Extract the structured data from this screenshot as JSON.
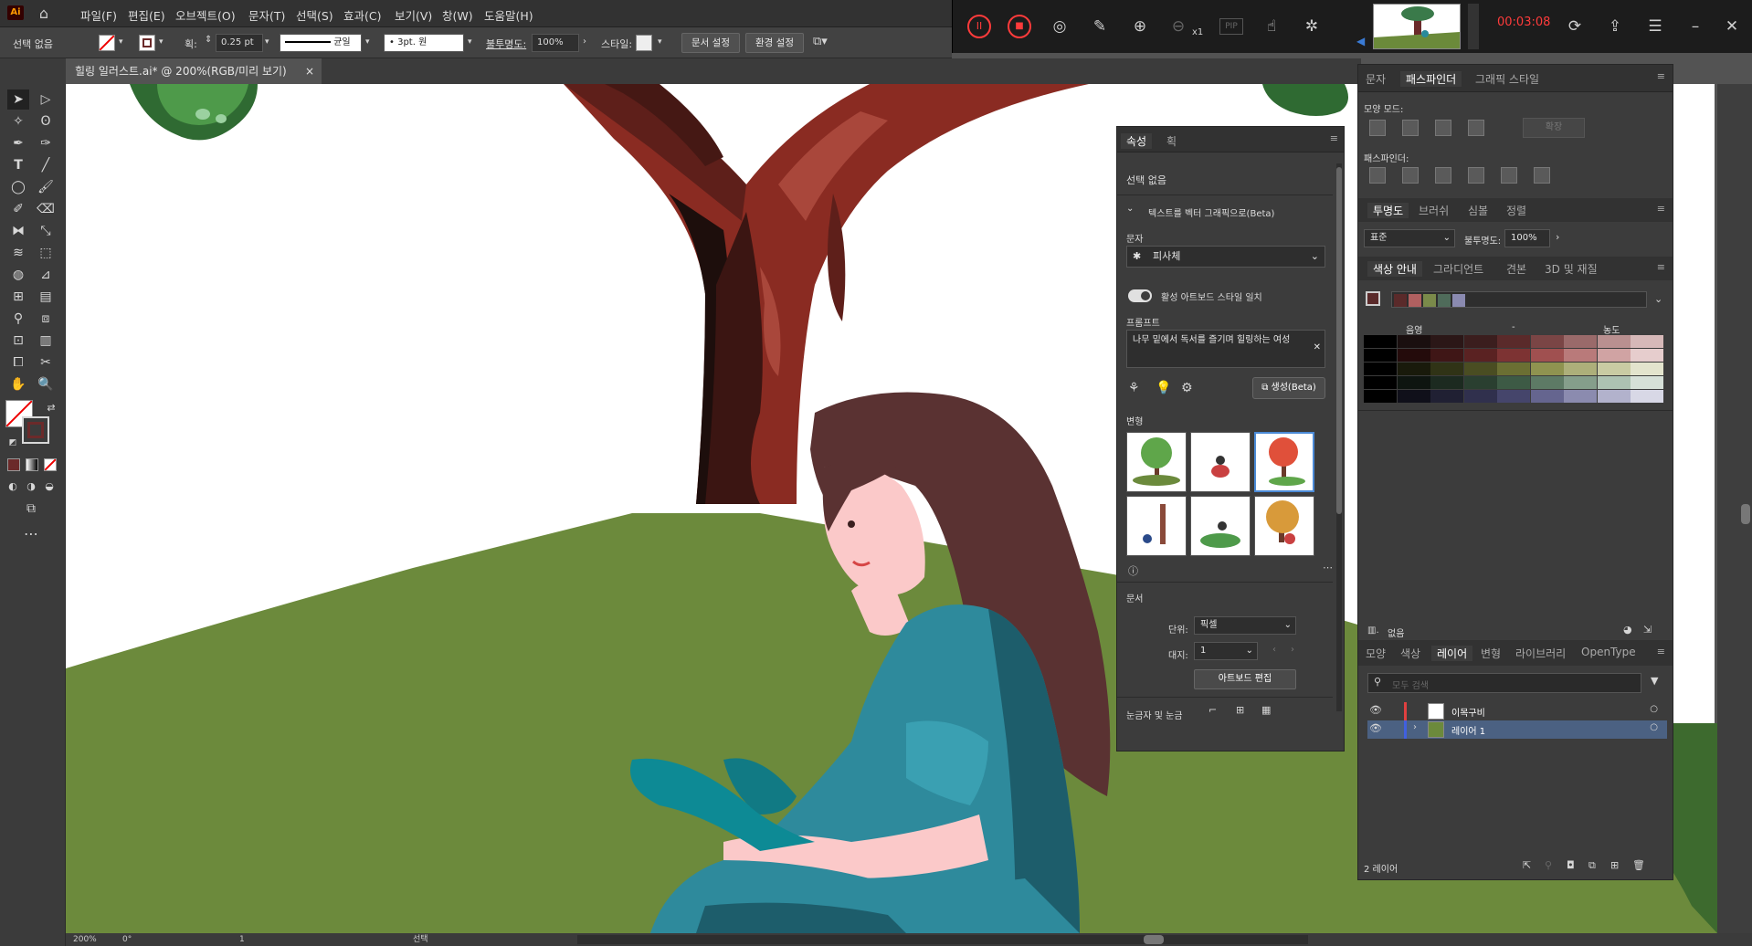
{
  "app": {
    "logo": "Ai",
    "home_icon": "home-icon"
  },
  "menu": [
    "파일(F)",
    "편집(E)",
    "오브젝트(O)",
    "문자(T)",
    "선택(S)",
    "효과(C)",
    "보기(V)",
    "창(W)",
    "도움말(H)"
  ],
  "recorder": {
    "time": "00:03:08",
    "zoom_label": "x1",
    "pip_label": "PIP"
  },
  "control": {
    "selection": "선택 없음",
    "stroke_label": "획:",
    "stroke_value": "0.25 pt",
    "line_style": "균일",
    "brush": "3pt. 원",
    "opacity_label": "불투명도:",
    "opacity_value": "100%",
    "style_label": "스타일:",
    "doc_setup": "문서 설정",
    "prefs": "환경 설정"
  },
  "doc_tab": "힐링 일러스트.ai* @ 200%(RGB/미리 보기)",
  "properties": {
    "tabs": [
      "속성",
      "획"
    ],
    "no_selection": "선택 없음",
    "text_to_vector": "텍스트를 벡터 그래픽으로(Beta)",
    "type_label": "문자",
    "type_value": "피사체",
    "match_style": "활성 아트보드 스타일 일치",
    "prompt_label": "프롬프트",
    "prompt_value": "나무 밑에서 독서를 즐기며 힐링하는 여성",
    "generate": "생성(Beta)",
    "variations_label": "변형",
    "document_label": "문서",
    "units_label": "단위:",
    "units_value": "픽셀",
    "artboard_label": "대지:",
    "artboard_value": "1",
    "edit_artboard": "아트보드 편집",
    "rulers_label": "눈금자 및 눈금"
  },
  "pathfinder": {
    "tabs": [
      "문자",
      "패스파인더",
      "그래픽 스타일"
    ],
    "shape_modes": "모양 모드:",
    "expand": "확장",
    "pathfinders": "패스파인더:"
  },
  "transparency": {
    "tabs": [
      "투명도",
      "브러쉬",
      "심볼",
      "정렬"
    ],
    "mode": "표준",
    "opacity_label": "불투명도:",
    "opacity_value": "100%"
  },
  "color_guide": {
    "tabs": [
      "색상 안내",
      "그라디언트",
      "견본",
      "3D 및 재질"
    ],
    "shade_label": "음영",
    "tint_label": "농도",
    "none_label": "없음",
    "harmony": [
      "#5a2a2a",
      "#b06060",
      "#7a8a4a",
      "#4f6b5a",
      "#8a8ab0"
    ],
    "grid_colors": [
      [
        "#000000",
        "#1a0f0f",
        "#2b1717",
        "#3b1e1e",
        "#5a2a2a",
        "#7a4545",
        "#9a6a6a",
        "#b99090",
        "#d6b8b8"
      ],
      [
        "#000000",
        "#240b0b",
        "#3f1616",
        "#5a2222",
        "#7d3333",
        "#a05050",
        "#b97a7a",
        "#d0a3a3",
        "#e6cdcd"
      ],
      [
        "#000000",
        "#191a0b",
        "#303316",
        "#4a4d22",
        "#6b6f33",
        "#8f9350",
        "#adaf7a",
        "#c9cba3",
        "#e3e4cd"
      ],
      [
        "#000000",
        "#0e1510",
        "#1c2a20",
        "#2a3f30",
        "#3d5a45",
        "#5d7a65",
        "#859e8b",
        "#adc2b2",
        "#d6e0d8"
      ],
      [
        "#000000",
        "#10101a",
        "#202033",
        "#30304d",
        "#45456b",
        "#65658f",
        "#8b8baf",
        "#b2b2cc",
        "#d8d8e6"
      ]
    ]
  },
  "layers": {
    "tabs": [
      "모양",
      "색상",
      "레이어",
      "변형",
      "라이브러리",
      "OpenType"
    ],
    "search_placeholder": "모두 검색",
    "items": [
      {
        "name": "이목구비",
        "color": "#e04040"
      },
      {
        "name": "레이어 1",
        "color": "#4060e0"
      }
    ],
    "count": "2 레이어"
  },
  "status": {
    "zoom": "200%",
    "rotate": "0°",
    "artboard": "1",
    "tool": "선택"
  },
  "colors": {
    "accent": "#4b6182",
    "record_red": "#ff3b3b"
  }
}
